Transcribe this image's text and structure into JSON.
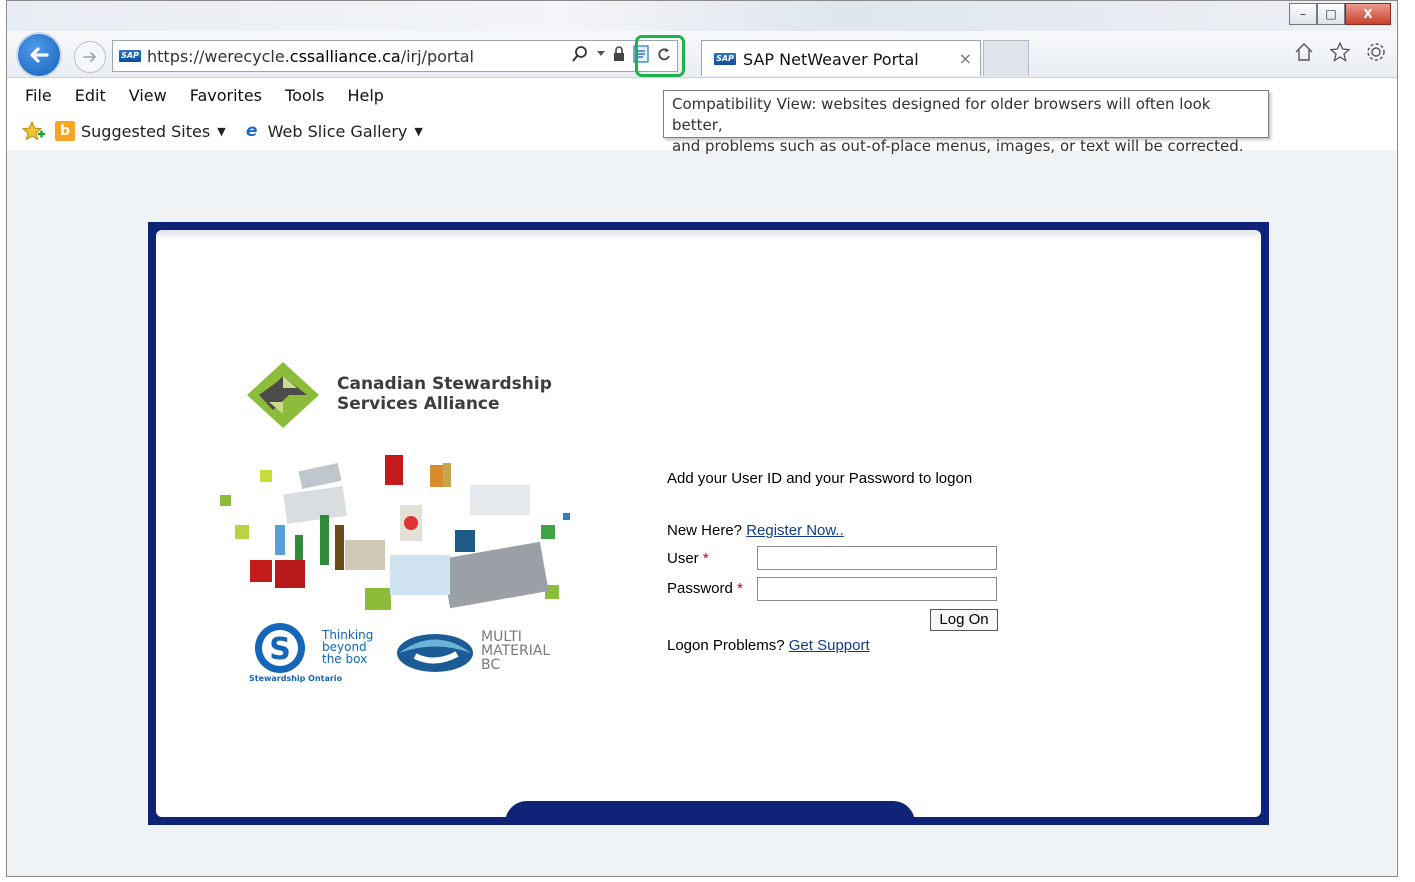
{
  "browser": {
    "url_prefix": "https://werecycle.",
    "url_domain": "cssalliance.ca",
    "url_path": "/irj/portal",
    "tab_title": "SAP NetWeaver Portal",
    "tab_close": "×",
    "window_controls": {
      "minimize": "–",
      "maximize": "□",
      "close": "X"
    },
    "favicon_label": "SAP"
  },
  "menu": {
    "items": [
      "File",
      "Edit",
      "View",
      "Favorites",
      "Tools",
      "Help"
    ]
  },
  "favorites_bar": {
    "suggested_sites": "Suggested Sites",
    "web_slice_gallery": "Web Slice Gallery"
  },
  "tooltip": {
    "line1": "Compatibility View: websites designed for older browsers will often look better,",
    "line2": "and problems such as out-of-place menus, images, or text will be corrected."
  },
  "portal": {
    "logo_line1": "Canadian Stewardship",
    "logo_line2": "Services Alliance",
    "partner1_text": "Thinking beyond the box",
    "partner1_caption": "Stewardship Ontario",
    "partner2_text": "MULTI MATERIAL BC",
    "login": {
      "intro": "Add your User ID and your Password to logon",
      "new_here": "New Here?",
      "register_link": "Register Now..",
      "user_label": "User",
      "password_label": "Password",
      "required_mark": "*",
      "user_value": "",
      "password_value": "",
      "logon_button": "Log On",
      "problems": "Logon Problems?",
      "support_link": "Get Support"
    }
  },
  "colors": {
    "portal_frame": "#0f2476",
    "compat_highlight": "#1eb14a",
    "link": "#0f3b8a"
  }
}
